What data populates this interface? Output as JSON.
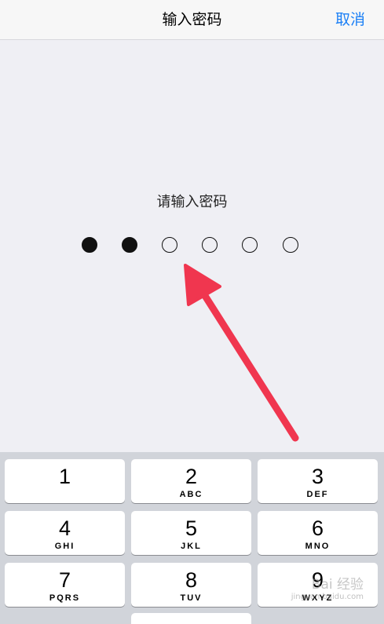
{
  "navbar": {
    "title": "输入密码",
    "cancel_label": "取消"
  },
  "prompt": "请输入密码",
  "passcode": {
    "length": 6,
    "entered": 2
  },
  "keypad": {
    "keys": [
      {
        "number": "1",
        "letters": ""
      },
      {
        "number": "2",
        "letters": "ABC"
      },
      {
        "number": "3",
        "letters": "DEF"
      },
      {
        "number": "4",
        "letters": "GHI"
      },
      {
        "number": "5",
        "letters": "JKL"
      },
      {
        "number": "6",
        "letters": "MNO"
      },
      {
        "number": "7",
        "letters": "PQRS"
      },
      {
        "number": "8",
        "letters": "TUV"
      },
      {
        "number": "9",
        "letters": "WXYZ"
      }
    ]
  },
  "watermark": {
    "line1": "Bai 经验",
    "line2": "jingyan.baidu.com"
  },
  "colors": {
    "accent": "#1a7ff6",
    "arrow": "#f0364f",
    "background": "#efeff4",
    "keypad_bg": "#d1d4da"
  }
}
